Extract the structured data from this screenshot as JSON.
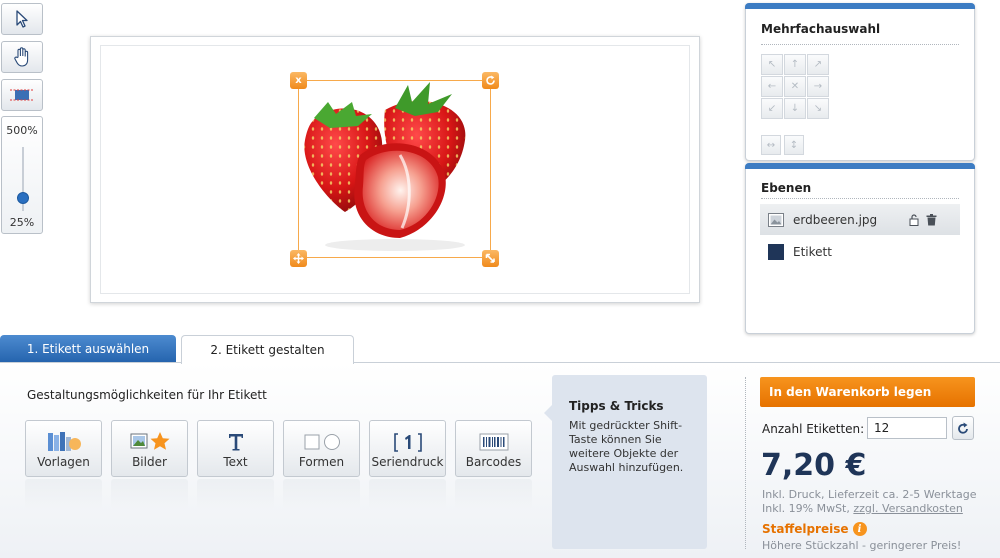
{
  "toolbar": {
    "select_icon": "pointer-icon",
    "pan_icon": "hand-icon",
    "align_icon": "align-icon",
    "zoom_max": "500%",
    "zoom_min": "25%",
    "zoom_level_fraction": 0.25
  },
  "canvas": {
    "image_name": "erdbeeren.jpg",
    "handles": {
      "delete": "x",
      "rotate": "rotate-icon",
      "move": "move-icon",
      "resize": "resize-icon"
    }
  },
  "multi_select": {
    "title": "Mehrfachauswahl",
    "arrows": [
      "↖",
      "↑",
      "↗",
      "←",
      "✕",
      "→",
      "↙",
      "↓",
      "↘"
    ],
    "distribute": [
      "↔",
      "↕"
    ]
  },
  "layers": {
    "title": "Ebenen",
    "items": [
      {
        "label": "erdbeeren.jpg",
        "type": "image"
      },
      {
        "label": "Etikett",
        "type": "color",
        "color": "#1f3558"
      }
    ]
  },
  "tabs": [
    {
      "label": "1. Etikett auswählen"
    },
    {
      "label": "2. Etikett gestalten"
    }
  ],
  "design": {
    "title": "Gestaltungsmöglichkeiten für Ihr Etikett",
    "buttons": [
      {
        "label": "Vorlagen",
        "icon": "templates-icon"
      },
      {
        "label": "Bilder",
        "icon": "images-icon"
      },
      {
        "label": "Text",
        "icon": "text-icon"
      },
      {
        "label": "Formen",
        "icon": "shapes-icon"
      },
      {
        "label": "Seriendruck",
        "icon": "serial-print-icon"
      },
      {
        "label": "Barcodes",
        "icon": "barcode-icon"
      }
    ]
  },
  "tips": {
    "title": "Tipps & Tricks",
    "text": "Mit gedrückter Shift-Taste können Sie weitere Objekte der Auswahl hinzufügen."
  },
  "order": {
    "cart_button": "In den Warenkorb legen",
    "qty_label": "Anzahl Etiketten:",
    "qty_value": "12",
    "price": "7,20 €",
    "note_line1": "Inkl. Druck, Lieferzeit ca. 2-5 Werktage",
    "note_line2_prefix": "Inkl. 19% MwSt, ",
    "note_link": "zzgl. Versandkosten",
    "staffel_title": "Staffelpreise",
    "staffel_sub": "Höhere Stückzahl - geringerer Preis!"
  },
  "colors": {
    "accent_blue": "#2463ad",
    "orange": "#f7941e",
    "navy": "#1f3558"
  }
}
